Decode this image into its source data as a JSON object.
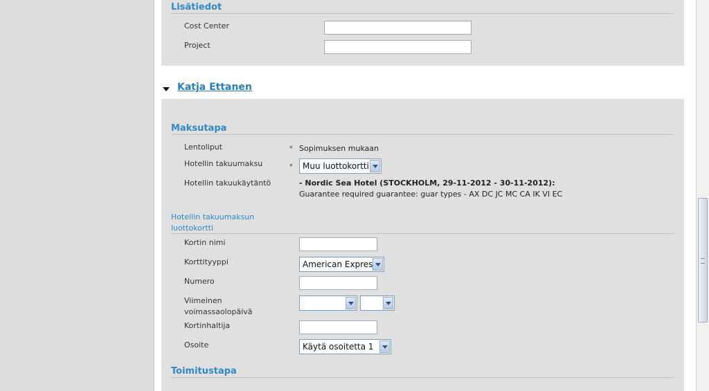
{
  "lisatiedot": {
    "title": "Lisätiedot",
    "fields": [
      {
        "label": "Cost Center",
        "value": ""
      },
      {
        "label": "Project",
        "value": ""
      }
    ]
  },
  "traveler": {
    "name": "Katja Ettanen"
  },
  "maksutapa": {
    "title": "Maksutapa",
    "lentoliput_label": "Lentoliput",
    "lentoliput_value": "Sopimuksen mukaan",
    "takuumaksu_label": "Hotellin takuumaksu",
    "takuumaksu_selected": "Muu luottokortti",
    "kaytanto_label": "Hotellin takuukäytäntö",
    "kaytanto_hotel": "- Nordic Sea Hotel (STOCKHOLM, 29-11-2012 - 30-11-2012):",
    "kaytanto_text": "Guarantee required guarantee: guar types - AX DC JC MC CA IK VI EC",
    "required_mark": "*"
  },
  "card": {
    "title_line1": "Hotellin takuumaksun",
    "title_line2": "luottokortti",
    "kortin_nimi_label": "Kortin nimi",
    "kortin_nimi_value": "",
    "korttityyppi_label": "Korttityyppi",
    "korttityyppi_selected": "American Express",
    "numero_label": "Numero",
    "numero_value": "",
    "expiry_label_line1": "Viimeinen",
    "expiry_label_line2": "voimassaolopäivä",
    "expiry_month": "",
    "expiry_year": "",
    "haltija_label": "Kortinhaltija",
    "haltija_value": "",
    "osoite_label": "Osoite",
    "osoite_selected": "Käytä osoitetta 1"
  },
  "toimitustapa": {
    "title": "Toimitustapa"
  }
}
